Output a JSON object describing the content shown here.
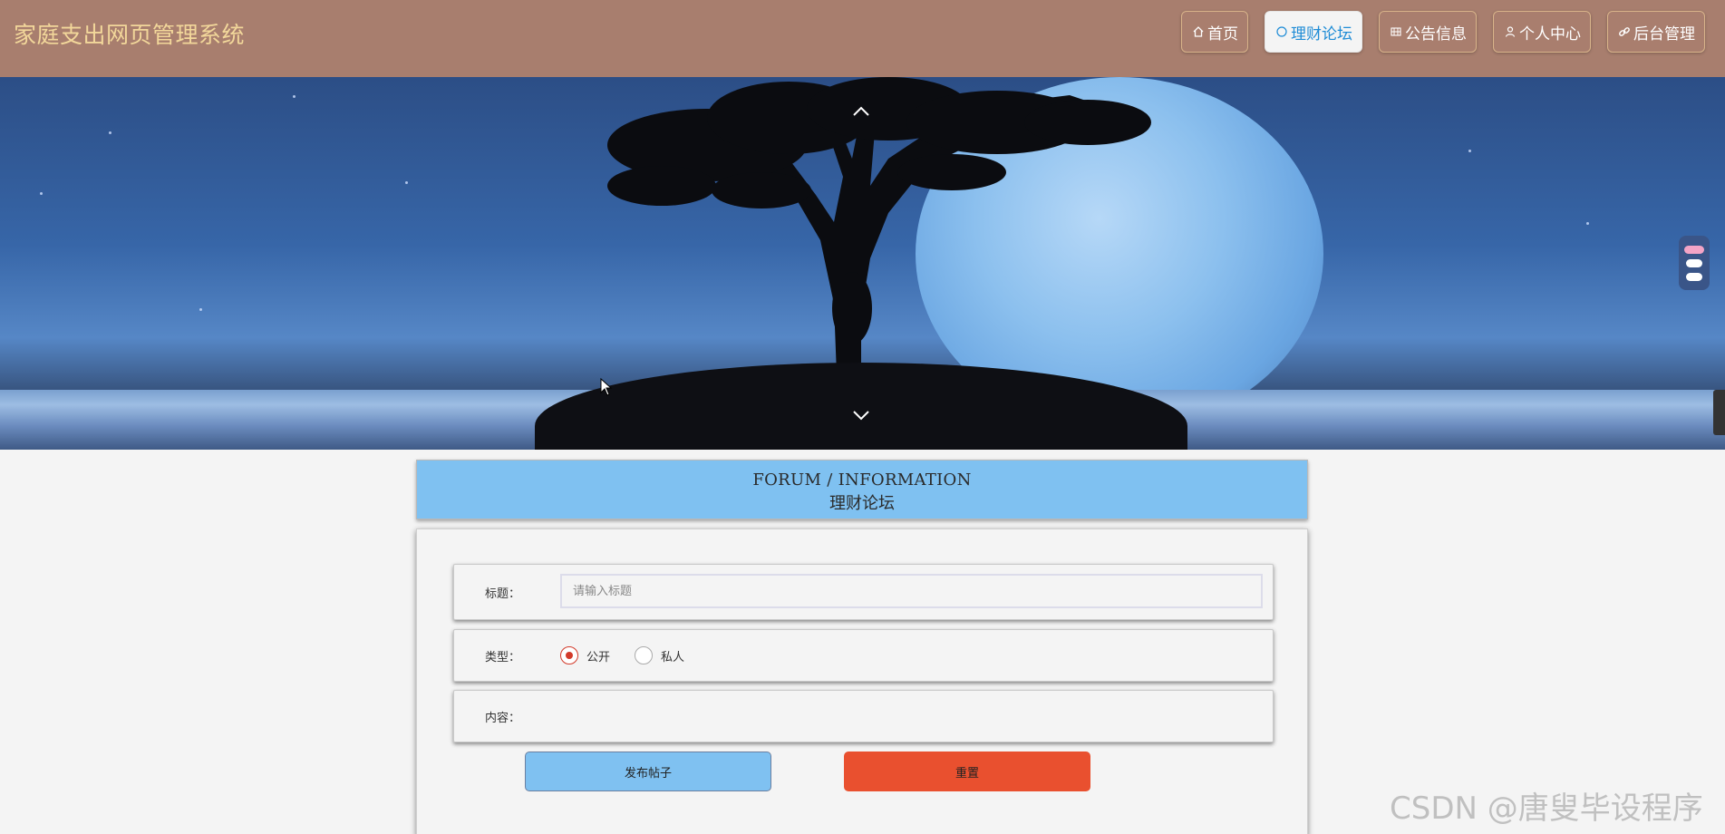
{
  "header": {
    "site_title": "家庭支出网页管理系统",
    "nav": [
      {
        "label": "首页",
        "icon": "home-icon"
      },
      {
        "label": "理财论坛",
        "icon": "circle-icon",
        "active": true
      },
      {
        "label": "公告信息",
        "icon": "grid-icon"
      },
      {
        "label": "个人中心",
        "icon": "user-icon"
      },
      {
        "label": "后台管理",
        "icon": "link-icon"
      }
    ]
  },
  "banner": {
    "slides": 3,
    "active_slide": 1
  },
  "section": {
    "title_en": "FORUM / INFORMATION",
    "title_cn": "理财论坛"
  },
  "form": {
    "title_label": "标题：",
    "title_placeholder": "请输入标题",
    "title_value": "",
    "type_label": "类型：",
    "type_options": [
      "公开",
      "私人"
    ],
    "type_selected": "公开",
    "content_label": "内容：",
    "submit_label": "发布帖子",
    "reset_label": "重置"
  },
  "watermark": "CSDN @唐叟毕设程序",
  "colors": {
    "header_bg": "#a87e6e",
    "site_title": "#f2d79a",
    "section_bg": "#7fc1f1",
    "submit_bg": "#7fc1f1",
    "reset_bg": "#e9502f",
    "radio_checked": "#d23a2a"
  }
}
